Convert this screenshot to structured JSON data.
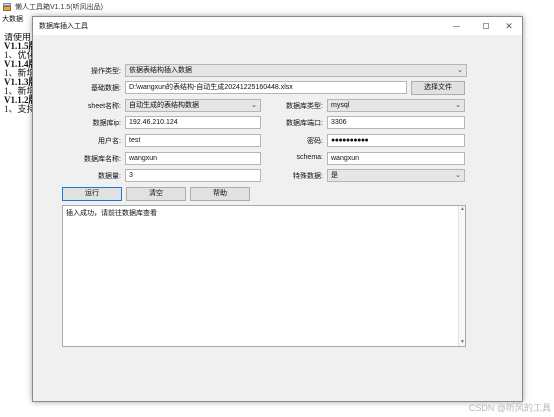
{
  "main_window": {
    "title": "懒人工具箱V1.1.5(听风出品)",
    "menu_label": "大数据",
    "background_text": [
      "请使用",
      "V1.1.5版",
      "1、优化",
      "V1.1.4版",
      "1、新增",
      "V1.1.3版",
      "1、新增",
      "V1.1.2版",
      "1、支持"
    ]
  },
  "dialog": {
    "title": "数据库插入工具",
    "op_type": {
      "label": "操作类型:",
      "value": "依据表结构插入数据"
    },
    "base_data": {
      "label": "基础数据:",
      "value": "D:\\wangxun的表结构-自动生成20241225160448.xlsx",
      "button": "选择文件"
    },
    "sheet": {
      "label": "sheet名称:",
      "value": "自动生成的表结构数据"
    },
    "db_type": {
      "label": "数据库类型:",
      "value": "mysql"
    },
    "db_ip": {
      "label": "数据库ip:",
      "value": "192.46.210.124"
    },
    "db_port": {
      "label": "数据库端口:",
      "value": "3306"
    },
    "username": {
      "label": "用户名:",
      "value": "test"
    },
    "password": {
      "label": "密码:",
      "value": "●●●●●●●●●●"
    },
    "db_name": {
      "label": "数据库名称:",
      "value": "wangxun"
    },
    "schema": {
      "label": "schema:",
      "value": "wangxun"
    },
    "data_count": {
      "label": "数据量:",
      "value": "3"
    },
    "special_data": {
      "label": "特殊数据:",
      "value": "是"
    },
    "buttons": {
      "run": "运行",
      "clear": "清空",
      "help": "帮助"
    },
    "output": "插入成功，请前往数据库查看"
  },
  "window_controls": {
    "minimize": "—",
    "close": "✕"
  },
  "watermark": "CSDN @听风的工具"
}
